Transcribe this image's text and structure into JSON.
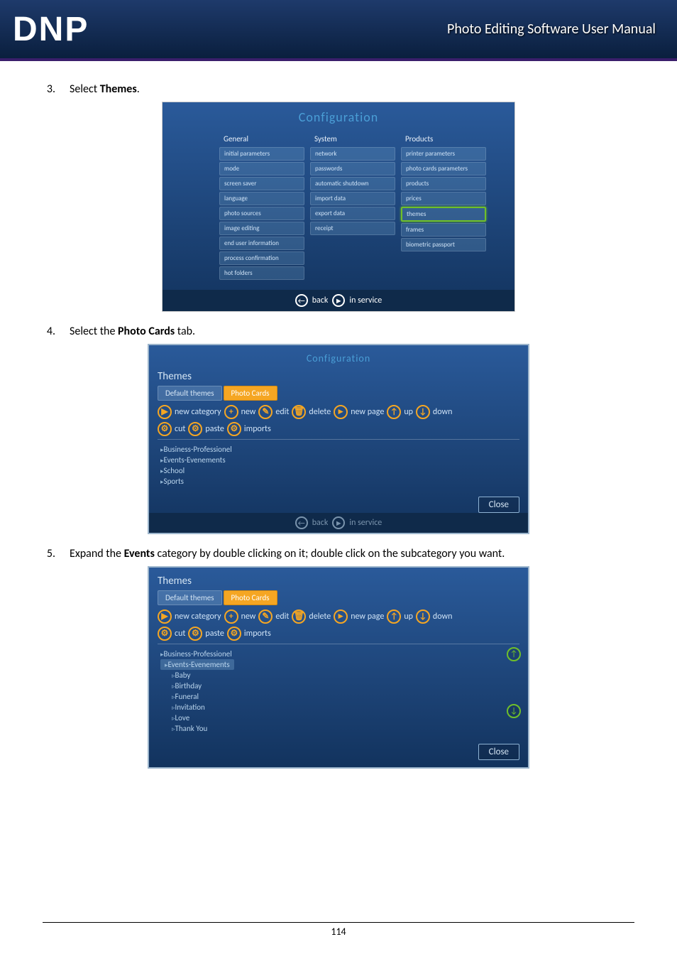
{
  "header": {
    "logo": "DNP",
    "manual_title": "Photo Editing Software User Manual"
  },
  "steps": {
    "s3": {
      "num": "3.",
      "pre": "Select ",
      "bold": "Themes",
      "post": "."
    },
    "s4": {
      "num": "4.",
      "pre": "Select the ",
      "bold": "Photo Cards",
      "post": " tab."
    },
    "s5": {
      "num": "5.",
      "pre": "Expand the ",
      "bold": "Events",
      "post": " category by double clicking on it; double click on the subcategory you want."
    }
  },
  "config_shot": {
    "title": "Configuration",
    "columns": {
      "general": {
        "head": "General",
        "items": [
          "initial parameters",
          "mode",
          "screen saver",
          "language",
          "photo sources",
          "image editing",
          "end user information",
          "process confirmation",
          "hot folders"
        ]
      },
      "system": {
        "head": "System",
        "items": [
          "network",
          "passwords",
          "automatic shutdown",
          "import data",
          "export data",
          "receipt"
        ]
      },
      "products": {
        "head": "Products",
        "items": [
          "printer parameters",
          "photo cards parameters",
          "products",
          "prices",
          "themes",
          "frames",
          "biometric passport"
        ]
      }
    },
    "bottom": {
      "back": "back",
      "in_service": "in service"
    }
  },
  "themes_shot1": {
    "top_title": "Configuration",
    "heading": "Themes",
    "tabs": {
      "default": "Default themes",
      "photo_cards": "Photo Cards"
    },
    "toolbar": {
      "new_category": "new category",
      "new": "new",
      "edit": "edit",
      "delete": "delete",
      "new_page": "new page",
      "up": "up",
      "down": "down",
      "cut": "cut",
      "paste": "paste",
      "imports": "imports"
    },
    "cats": [
      "Business-Professionel",
      "Events-Evenements",
      "School",
      "Sports"
    ],
    "close": "Close",
    "bottom": {
      "back": "back",
      "in_service": "in service"
    }
  },
  "themes_shot2": {
    "heading": "Themes",
    "tabs": {
      "default": "Default themes",
      "photo_cards": "Photo Cards"
    },
    "toolbar": {
      "new_category": "new category",
      "new": "new",
      "edit": "edit",
      "delete": "delete",
      "new_page": "new page",
      "up": "up",
      "down": "down",
      "cut": "cut",
      "paste": "paste",
      "imports": "imports"
    },
    "cats_top": "Business-Professionel",
    "cat_selected": "Events-Evenements",
    "subcats": [
      "Baby",
      "Birthday",
      "Funeral",
      "Invitation",
      "Love",
      "Thank You"
    ],
    "close": "Close"
  },
  "footer": {
    "page_number": "114"
  }
}
